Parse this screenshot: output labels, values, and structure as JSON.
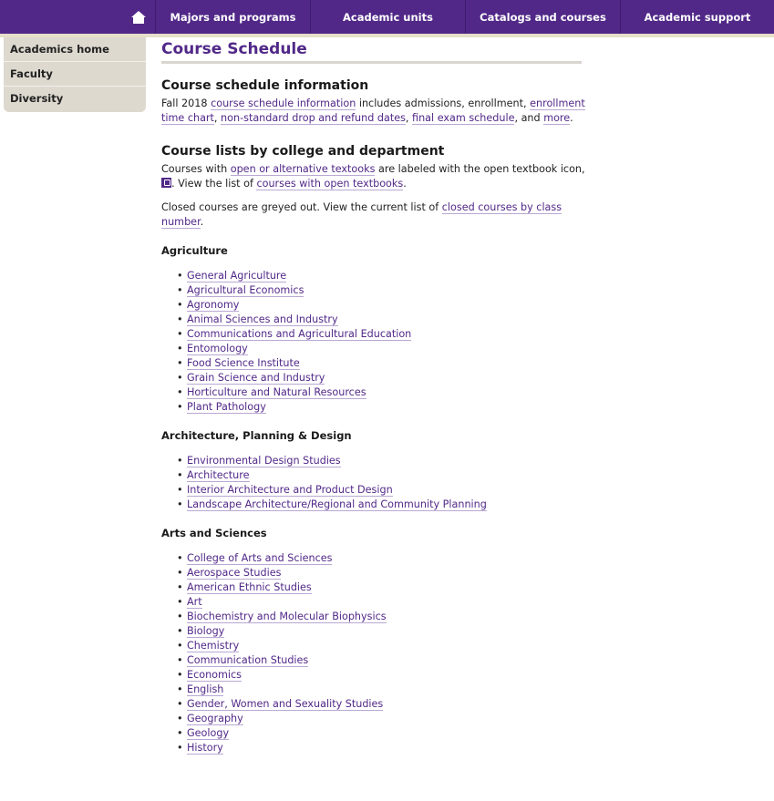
{
  "nav": {
    "home_icon": "home-icon",
    "items": [
      "Majors and programs",
      "Academic units",
      "Catalogs and courses",
      "Academic support"
    ]
  },
  "sidebar": {
    "items": [
      "Academics home",
      "Faculty",
      "Diversity"
    ]
  },
  "page_title": "Course Schedule",
  "info": {
    "heading": "Course schedule information",
    "t1": "Fall 2018 ",
    "l1": "course schedule information",
    "t2": " includes admissions, enrollment, ",
    "l2": "enrollment time chart",
    "t3": ", ",
    "l3": "non-standard drop and refund dates",
    "t4": ", ",
    "l4": "final exam schedule",
    "t5": ", and ",
    "l5": "more",
    "t6": "."
  },
  "lists": {
    "heading": "Course lists by college and department",
    "p1_t1": "Courses with ",
    "p1_l1": "open or alternative textooks",
    "p1_t2": " are labeled with the open textbook icon, ",
    "p1_t3": ". View the list of ",
    "p1_l2": "courses with open textbooks",
    "p1_t4": ".",
    "p2_t1": "Closed courses are greyed out. View the current list of ",
    "p2_l1": "closed courses by class number",
    "p2_t2": "."
  },
  "colleges": [
    {
      "name": "Agriculture",
      "depts": [
        "General Agriculture",
        "Agricultural Economics",
        "Agronomy",
        "Animal Sciences and Industry",
        "Communications and Agricultural Education",
        "Entomology",
        "Food Science Institute",
        "Grain Science and Industry",
        "Horticulture and Natural Resources",
        "Plant Pathology"
      ]
    },
    {
      "name": "Architecture, Planning & Design",
      "depts": [
        "Environmental Design Studies",
        "Architecture",
        "Interior Architecture and Product Design",
        "Landscape Architecture/Regional and Community Planning"
      ]
    },
    {
      "name": "Arts and Sciences",
      "depts": [
        "College of Arts and Sciences",
        "Aerospace Studies",
        "American Ethnic Studies",
        "Art",
        "Biochemistry and Molecular Biophysics",
        "Biology",
        "Chemistry",
        "Communication Studies",
        "Economics",
        "English",
        "Gender, Women and Sexuality Studies",
        "Geography",
        "Geology",
        "History"
      ]
    }
  ],
  "colors": {
    "brand_purple": "#512888",
    "sidebar_bg": "#ddd9cf"
  }
}
